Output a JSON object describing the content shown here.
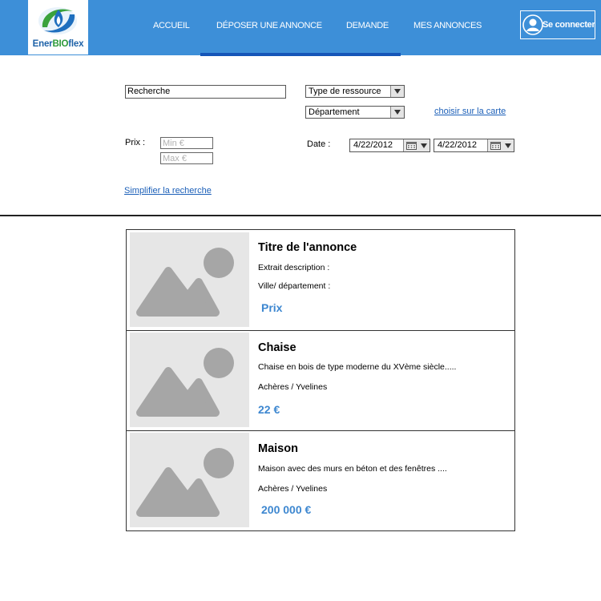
{
  "header": {
    "logo_text_1": "Ener",
    "logo_text_2": "BIO",
    "logo_text_3": "flex",
    "nav": [
      {
        "label": "ACCUEIL"
      },
      {
        "label": "DÉPOSER UNE ANNONCE"
      },
      {
        "label": "DEMANDE"
      },
      {
        "label": "MES ANNONCES"
      }
    ],
    "active_nav": "DÉPOSER UNE ANNONCE",
    "login_label": "Se connecter"
  },
  "search": {
    "query_value": "Recherche",
    "resource_type": "Type de ressource",
    "department": "Département",
    "map_link": "choisir sur la carte",
    "price_label": "Prix :",
    "price_min_placeholder": "Min   €",
    "price_max_placeholder": "Max   €",
    "date_label": "Date :",
    "date_from": "4/22/2012",
    "date_to": "4/22/2012",
    "simplify_link": "Simplifier la recherche"
  },
  "listings": [
    {
      "title": "Titre de l'annonce",
      "description": "Extrait description :",
      "location": "Ville/ département  :",
      "price": "Prix"
    },
    {
      "title": "Chaise",
      "description": "Chaise en bois de type moderne du XVème siècle.....",
      "location": "Achères / Yvelines",
      "price": "22  €"
    },
    {
      "title": "Maison",
      "description": "Maison avec des murs en béton et des fenêtres ....",
      "location": "Achères / Yvelines",
      "price": "200 000 €"
    }
  ],
  "colors": {
    "header_bg": "#3d8fd8",
    "nav_underline": "#1656b8",
    "price": "#3d87d0",
    "link": "#1b5fb8"
  },
  "icons": [
    "logo-icon",
    "user-icon",
    "calendar-icon",
    "image-placeholder-icon"
  ]
}
